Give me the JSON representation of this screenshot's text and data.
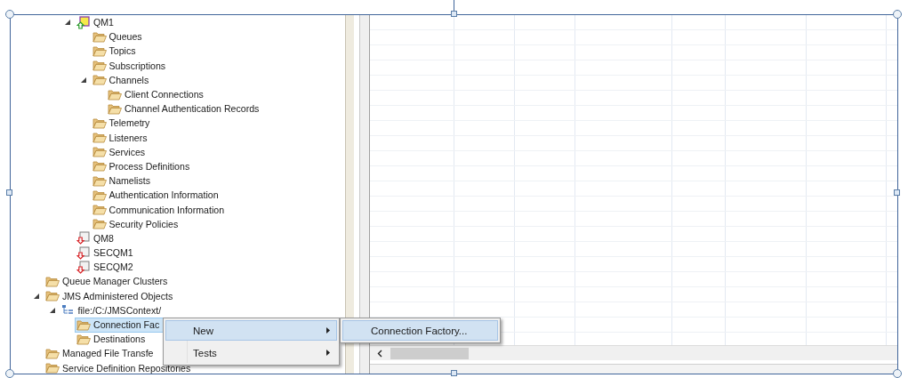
{
  "tree": {
    "queue_managers": [
      {
        "label": "QM1",
        "kind": "qmgr_running",
        "expanded": true,
        "selected": false,
        "children": [
          {
            "label": "Queues",
            "kind": "folder",
            "selected": false
          },
          {
            "label": "Topics",
            "kind": "folder",
            "selected": false
          },
          {
            "label": "Subscriptions",
            "kind": "folder",
            "selected": false
          },
          {
            "label": "Channels",
            "kind": "folder",
            "expanded": true,
            "selected": false,
            "children": [
              {
                "label": "Client Connections",
                "kind": "folder",
                "selected": false
              },
              {
                "label": "Channel Authentication Records",
                "kind": "folder",
                "selected": false
              }
            ]
          },
          {
            "label": "Telemetry",
            "kind": "folder",
            "selected": false
          },
          {
            "label": "Listeners",
            "kind": "folder",
            "selected": false
          },
          {
            "label": "Services",
            "kind": "folder",
            "selected": false
          },
          {
            "label": "Process Definitions",
            "kind": "folder",
            "selected": false
          },
          {
            "label": "Namelists",
            "kind": "folder",
            "selected": false
          },
          {
            "label": "Authentication Information",
            "kind": "folder",
            "selected": false
          },
          {
            "label": "Communication Information",
            "kind": "folder",
            "selected": false
          },
          {
            "label": "Security Policies",
            "kind": "folder",
            "selected": false
          }
        ]
      },
      {
        "label": "QM8",
        "kind": "qmgr_stopped",
        "selected": false
      },
      {
        "label": "SECQM1",
        "kind": "qmgr_stopped",
        "selected": false
      },
      {
        "label": "SECQM2",
        "kind": "qmgr_stopped",
        "selected": false
      }
    ],
    "items": [
      {
        "label": "Queue Manager Clusters",
        "kind": "folder",
        "selected": false
      },
      {
        "label": "JMS Administered Objects",
        "kind": "folder",
        "expanded": true,
        "selected": false,
        "children": [
          {
            "label": "file:/C:/JMSContext/",
            "kind": "context",
            "expanded": true,
            "selected": false,
            "children": [
              {
                "label": "Connection Fac",
                "kind": "folder",
                "selected": true
              },
              {
                "label": "Destinations",
                "kind": "folder",
                "selected": false
              }
            ]
          }
        ]
      },
      {
        "label": "Managed File Transfe",
        "kind": "folder",
        "selected": false
      },
      {
        "label": "Service Definition Repositories",
        "kind": "folder",
        "selected": false
      }
    ]
  },
  "context_menu": {
    "items": [
      {
        "label": "New",
        "selected": true,
        "submenu": true
      },
      {
        "label": "Tests",
        "selected": false,
        "submenu": true
      }
    ]
  },
  "submenu": {
    "items": [
      {
        "label": "Connection Factory...",
        "selected": true
      }
    ]
  }
}
